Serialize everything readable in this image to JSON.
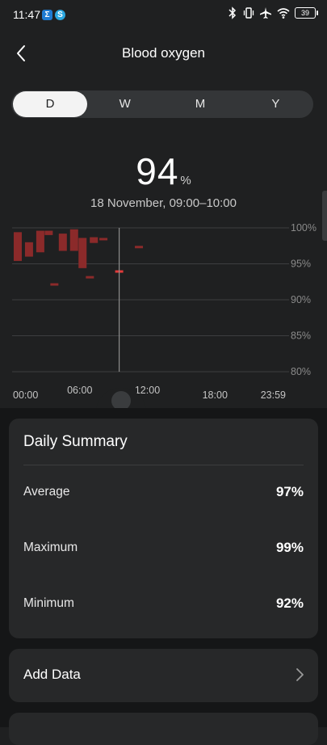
{
  "status_bar": {
    "time": "11:47",
    "app_icons": [
      {
        "name": "sigma-app-icon",
        "glyph": "Σ",
        "color": "#1f7bd1"
      },
      {
        "name": "skype-app-icon",
        "glyph": "S",
        "color": "#2ba7e0"
      }
    ],
    "icons": [
      "bluetooth-icon",
      "vibrate-icon",
      "airplane-icon",
      "wifi-icon"
    ],
    "battery": "39"
  },
  "header": {
    "title": "Blood oxygen",
    "back_icon": "chevron-left-icon"
  },
  "tabs": [
    {
      "label": "D",
      "active": true
    },
    {
      "label": "W",
      "active": false
    },
    {
      "label": "M",
      "active": false
    },
    {
      "label": "Y",
      "active": false
    }
  ],
  "reading": {
    "value": "94",
    "unit": "%",
    "period": "18 November, 09:00–10:00"
  },
  "chart_data": {
    "type": "bar",
    "subtype": "floating-range",
    "x_unit": "hours",
    "xlim": [
      0,
      24
    ],
    "ylim": [
      80,
      100
    ],
    "y_ticks": [
      {
        "value": 100,
        "label": "100%"
      },
      {
        "value": 95,
        "label": "95%"
      },
      {
        "value": 90,
        "label": "90%"
      },
      {
        "value": 85,
        "label": "85%"
      },
      {
        "value": 80,
        "label": "80%"
      }
    ],
    "x_tick_labels": [
      {
        "value": 0,
        "label": "00:00"
      },
      {
        "value": 6,
        "label": "06:00"
      },
      {
        "value": 12,
        "label": "12:00"
      },
      {
        "value": 18,
        "label": "18:00"
      },
      {
        "value": 24,
        "label": "23:59"
      }
    ],
    "bar_color": "#8b2a2a",
    "selected_color": "#e23b3b",
    "grid": true,
    "ranges": [
      {
        "x": 0.5,
        "low": 95.4,
        "high": 99.4
      },
      {
        "x": 1.5,
        "low": 96.0,
        "high": 98.0
      },
      {
        "x": 2.5,
        "low": 96.6,
        "high": 99.6
      },
      {
        "x": 3.25,
        "low": 99.0,
        "high": 99.6
      },
      {
        "x": 3.75,
        "low": 92.1,
        "high": 92.3
      },
      {
        "x": 4.5,
        "low": 96.8,
        "high": 99.2
      },
      {
        "x": 5.5,
        "low": 96.8,
        "high": 99.8
      },
      {
        "x": 6.25,
        "low": 94.4,
        "high": 98.6
      },
      {
        "x": 6.9,
        "low": 93.1,
        "high": 93.3
      },
      {
        "x": 7.25,
        "low": 97.9,
        "high": 98.7
      },
      {
        "x": 8.1,
        "low": 98.4,
        "high": 98.6
      },
      {
        "x": 9.5,
        "low": 93.9,
        "high": 94.1,
        "selected": true
      },
      {
        "x": 11.25,
        "low": 97.3,
        "high": 97.5
      }
    ],
    "selected_x": 9.5
  },
  "summary": {
    "title": "Daily Summary",
    "rows": [
      {
        "label": "Average",
        "value": "97%"
      },
      {
        "label": "Maximum",
        "value": "99%"
      },
      {
        "label": "Minimum",
        "value": "92%"
      }
    ]
  },
  "add_data": {
    "label": "Add Data",
    "icon": "chevron-right-icon"
  }
}
